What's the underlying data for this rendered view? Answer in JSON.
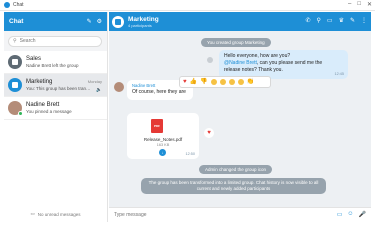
{
  "window": {
    "title": "Chat",
    "controls": [
      "–",
      "□",
      "✕"
    ]
  },
  "sidebar": {
    "title": "Chat",
    "actions": [
      "compose-icon",
      "settings-icon"
    ],
    "search_placeholder": "Search",
    "items": [
      {
        "name": "Sales",
        "preview": "Nadine Brett left the group",
        "day": ""
      },
      {
        "name": "Marketing",
        "preview": "You: This group has been tran…",
        "day": "Monday"
      },
      {
        "name": "Nadine Brett",
        "preview": "You pinned a message",
        "day": ""
      }
    ],
    "footer": "No unread messages"
  },
  "chat": {
    "name": "Marketing",
    "subtitle": "4 participants",
    "header_icons": [
      "phone-icon",
      "search-icon",
      "screen-icon",
      "admin-icon",
      "edit-icon",
      "more-icon"
    ],
    "system_created": "You created group Marketing",
    "msg1_line1": "Hello everyone, how are you?",
    "msg1_mention": "@Nadine Brett",
    "msg1_rest": ", can you please send me the",
    "msg1_line3": "release notes? Thank you.",
    "msg1_time": "12:45",
    "reply_sender": "Nadine Brett",
    "reply_text": "Of course, here they are",
    "file_name": "Release_Notes.pdf",
    "file_size": "163 KB",
    "file_time": "12:50",
    "system_changed": "Admin changed the group icon",
    "system_transformed_line1": "The group has been transformed into a limited group. Chat history is now visible to all",
    "system_transformed_line2": "current and newly added participants",
    "composer_placeholder": "Type message",
    "colors": {
      "accent": "#1e8fd6",
      "outgoing_bubble": "#d9ecfb",
      "background": "#edf0f3"
    }
  }
}
